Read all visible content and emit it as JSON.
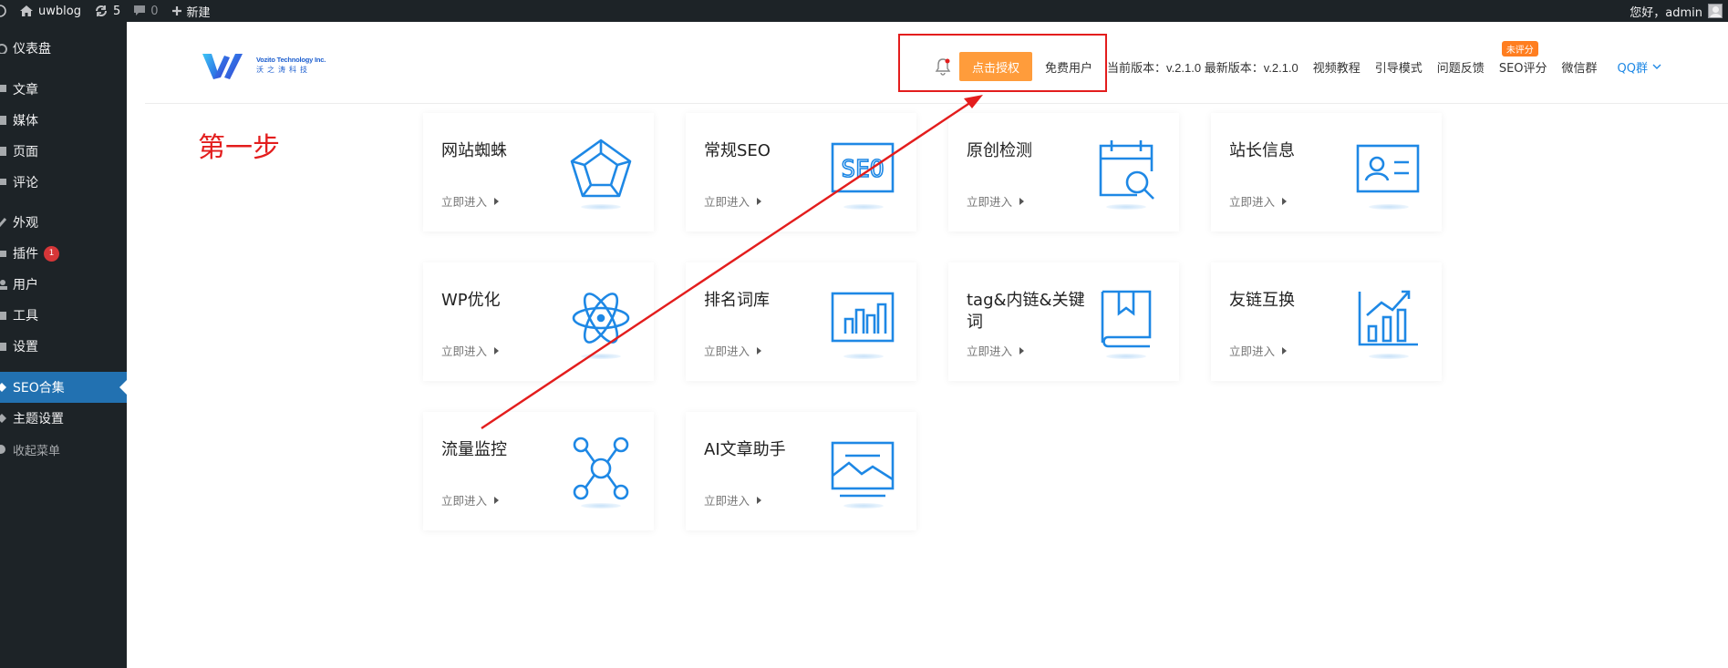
{
  "adminbar": {
    "site_name": "uwblog",
    "updates_count": "5",
    "comments_count": "0",
    "new_label": "新建",
    "greeting": "您好，admin"
  },
  "sidebar": {
    "items": [
      {
        "label": "仪表盘",
        "icon": "dashboard-icon"
      },
      {
        "label": "文章",
        "icon": "pin-icon"
      },
      {
        "label": "媒体",
        "icon": "media-icon"
      },
      {
        "label": "页面",
        "icon": "page-icon"
      },
      {
        "label": "评论",
        "icon": "comment-icon"
      },
      {
        "label": "外观",
        "icon": "brush-icon"
      },
      {
        "label": "插件",
        "icon": "plugin-icon",
        "badge": "1"
      },
      {
        "label": "用户",
        "icon": "user-icon"
      },
      {
        "label": "工具",
        "icon": "wrench-icon"
      },
      {
        "label": "设置",
        "icon": "settings-icon"
      },
      {
        "label": "SEO合集",
        "icon": "seo-icon",
        "active": true
      },
      {
        "label": "主题设置",
        "icon": "theme-icon"
      },
      {
        "label": "收起菜单",
        "icon": "collapse-icon"
      }
    ]
  },
  "brand": {
    "logo_en": "Vozito Technology Inc.",
    "logo_cn": "沃之涛科技"
  },
  "nav": {
    "auth_button": "点击授权",
    "free_user": "免费用户",
    "version": "当前版本：v.2.1.0 最新版本：v.2.1.0",
    "video_tutorial": "视频教程",
    "guide_mode": "引导模式",
    "feedback": "问题反馈",
    "seo_score": "SEO评分",
    "seo_score_tag": "未评分",
    "wechat_group": "微信群",
    "qq_group": "QQ群"
  },
  "annotation": {
    "step": "第一步"
  },
  "cards": [
    {
      "title": "网站蜘蛛",
      "link": "立即进入",
      "icon": "pentagon-web-icon"
    },
    {
      "title": "常规SEO",
      "link": "立即进入",
      "icon": "seo-text-icon"
    },
    {
      "title": "原创检测",
      "link": "立即进入",
      "icon": "calendar-search-icon"
    },
    {
      "title": "站长信息",
      "link": "立即进入",
      "icon": "id-card-icon"
    },
    {
      "title": "WP优化",
      "link": "立即进入",
      "icon": "atom-icon"
    },
    {
      "title": "排名词库",
      "link": "立即进入",
      "icon": "bar-chart-icon"
    },
    {
      "title": "tag&内链&关键词",
      "link": "立即进入",
      "icon": "bookmark-book-icon"
    },
    {
      "title": "友链互换",
      "link": "立即进入",
      "icon": "trend-chart-icon"
    },
    {
      "title": "流量监控",
      "link": "立即进入",
      "icon": "network-nodes-icon"
    },
    {
      "title": "AI文章助手",
      "link": "立即进入",
      "icon": "image-frame-icon"
    }
  ],
  "colors": {
    "admin_dark": "#1d2327",
    "active_blue": "#2271b1",
    "icon_blue": "#1e88e5",
    "auth_orange": "#ff9c3b",
    "annotation_red": "#e31d1d"
  }
}
